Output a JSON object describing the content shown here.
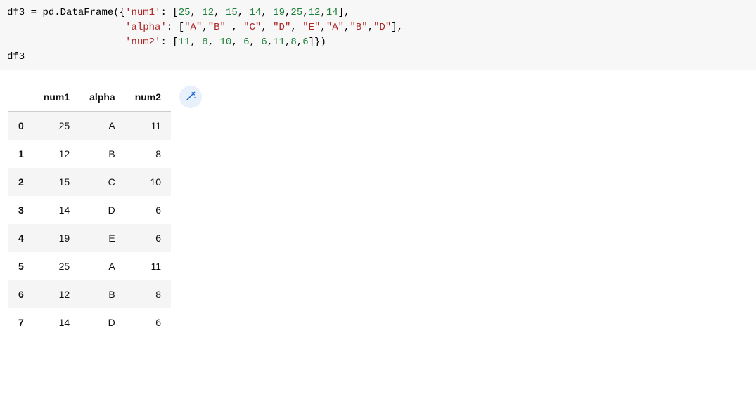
{
  "code": {
    "line1_full": "df3 = pd.DataFrame({'num1': [25, 12, 15, 14, 19,25,12,14],",
    "line2_full": "                    'alpha': [\"A\",\"B\" , \"C\", \"D\", \"E\",\"A\",\"B\",\"D\"],",
    "line3_full": "                    'num2': [11, 8, 10, 6, 6,11,8,6]})",
    "line4_full": "df3",
    "l1": {
      "var": "df3",
      "assign": " = ",
      "call": "pd.DataFrame({",
      "k1": "'num1'",
      "colon": ": [",
      "n0": "25",
      "c": ", ",
      "n1": "12",
      "n2": "15",
      "n3": "14",
      "n4": "19",
      "cTight": ",",
      "n5": "25",
      "n6": "12",
      "n7": "14",
      "end": "],"
    },
    "l2": {
      "indent": "                    ",
      "k": "'alpha'",
      "colon": ": [",
      "s0": "\"A\"",
      "c": ",",
      "s1": "\"B\"",
      "gap": " , ",
      "s2": "\"C\"",
      "cs": ", ",
      "s3": "\"D\"",
      "s4": "\"E\"",
      "s5": "\"A\"",
      "s6": "\"B\"",
      "s7": "\"D\"",
      "end": "],"
    },
    "l3": {
      "indent": "                    ",
      "k": "'num2'",
      "colon": ": [",
      "n0": "11",
      "cs": ", ",
      "n1": "8",
      "n2": "10",
      "n3": "6",
      "n4": "6",
      "c": ",",
      "n5": "11",
      "n6": "8",
      "n7": "6",
      "end": "]})"
    },
    "l4": "df3"
  },
  "table": {
    "headers": {
      "col0": "num1",
      "col1": "alpha",
      "col2": "num2"
    },
    "rows": [
      {
        "idx": "0",
        "num1": "25",
        "alpha": "A",
        "num2": "11"
      },
      {
        "idx": "1",
        "num1": "12",
        "alpha": "B",
        "num2": "8"
      },
      {
        "idx": "2",
        "num1": "15",
        "alpha": "C",
        "num2": "10"
      },
      {
        "idx": "3",
        "num1": "14",
        "alpha": "D",
        "num2": "6"
      },
      {
        "idx": "4",
        "num1": "19",
        "alpha": "E",
        "num2": "6"
      },
      {
        "idx": "5",
        "num1": "25",
        "alpha": "A",
        "num2": "11"
      },
      {
        "idx": "6",
        "num1": "12",
        "alpha": "B",
        "num2": "8"
      },
      {
        "idx": "7",
        "num1": "14",
        "alpha": "D",
        "num2": "6"
      }
    ]
  },
  "icons": {
    "magic": "magic-wand-icon"
  }
}
